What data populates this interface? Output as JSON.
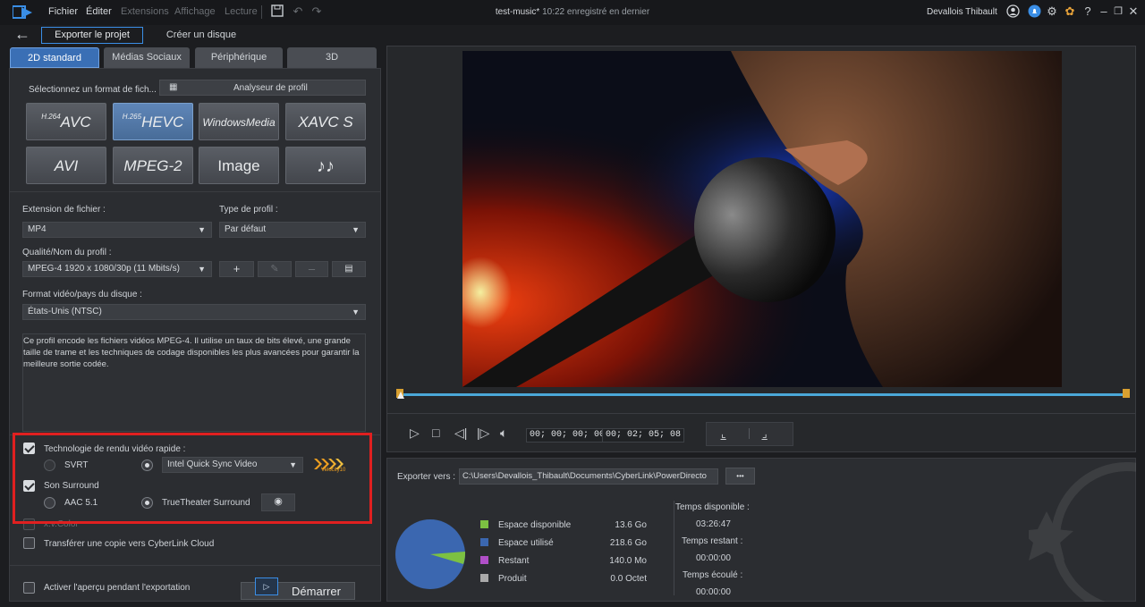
{
  "menu": {
    "items": [
      "Fichier",
      "Éditer",
      "Extensions",
      "Affichage",
      "Lecture"
    ],
    "disabled": [
      false,
      false,
      true,
      true,
      true
    ]
  },
  "titlebar": {
    "project": "test-music*",
    "saved": "10:22 enregistré en dernier",
    "user": "Devallois Thibault"
  },
  "subbar": {
    "export_tab": "Exporter le projet",
    "disc_tab": "Créer un disque"
  },
  "tabs": [
    "2D standard",
    "Médias Sociaux",
    "Périphérique",
    "3D"
  ],
  "left": {
    "select_format": "Sélectionnez un format de fich...",
    "profile_analyzer": "Analyseur de profil",
    "formats": {
      "avc_sup": "H.264",
      "avc": "AVC",
      "hevc_sup": "H.265",
      "hevc": "HEVC",
      "wmv": "WindowsMedia",
      "xavc": "XAVC S",
      "avi": "AVI",
      "mpeg2": "MPEG-2",
      "image": "Image",
      "audio": "♪♪"
    },
    "file_ext_label": "Extension de fichier :",
    "file_ext_value": "MP4",
    "profile_type_label": "Type de profil :",
    "profile_type_value": "Par défaut",
    "quality_label": "Qualité/Nom du profil :",
    "quality_value": "MPEG-4 1920 x 1080/30p (11 Mbits/s)",
    "disc_format_label": "Format vidéo/pays du disque :",
    "disc_format_value": "États-Unis (NTSC)",
    "description": "Ce profil encode les fichiers vidéos MPEG-4.  Il utilise un taux de bits élevé, une grande taille de trame et les techniques de codage disponibles les plus avancées pour garantir la meilleure sortie codée.",
    "fast_render_label": "Technologie de rendu vidéo rapide :",
    "svrt": "SVRT",
    "intel_qsv": "Intel Quick Sync Video",
    "velocity_badge": "Velocity10",
    "surround_label": "Son Surround",
    "aac51": "AAC 5.1",
    "truetheater": "TrueTheater Surround",
    "xvcolor": "x.v.Color",
    "cloud_copy": "Transférer une copie vers CyberLink Cloud",
    "preview_during_export": "Activer l'aperçu pendant l'exportation",
    "start": "Démarrer"
  },
  "player": {
    "timecode_current": "00; 00; 00; 00",
    "timecode_total": "00; 02; 05; 08"
  },
  "export": {
    "export_to_label": "Exporter vers :",
    "export_path": "C:\\Users\\Devallois_Thibault\\Documents\\CyberLink\\PowerDirecto",
    "browse": "•••",
    "legend": [
      {
        "label": "Espace disponible",
        "value": "13.6  Go",
        "color": "#7cc142"
      },
      {
        "label": "Espace utilisé",
        "value": "218.6  Go",
        "color": "#3b67b0"
      },
      {
        "label": "Restant",
        "value": "140.0  Mo",
        "color": "#b04fc8"
      },
      {
        "label": "Produit",
        "value": "0.0  Octet",
        "color": "#aaaaaa"
      }
    ],
    "time_available_label": "Temps disponible :",
    "time_available": "03:26:47",
    "time_remaining_label": "Temps restant :",
    "time_remaining": "00:00:00",
    "time_elapsed_label": "Temps écoulé :",
    "time_elapsed": "00:00:00"
  },
  "colors": {
    "accent": "#3a6fb5",
    "highlight_box": "#e02020",
    "timeline": "#4aa8d8"
  }
}
